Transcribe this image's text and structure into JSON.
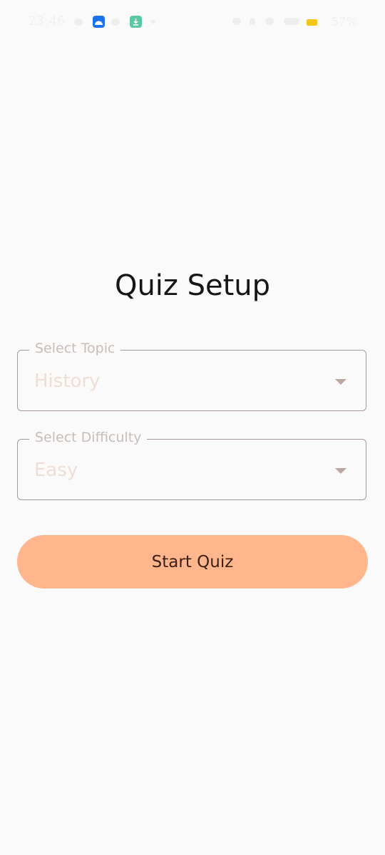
{
  "status_bar": {
    "time": "23:46",
    "battery_percent": "57%",
    "battery_color": "#f5c518",
    "app_icons": [
      "android-app-icon",
      "download-icon"
    ]
  },
  "screen": {
    "title": "Quiz Setup"
  },
  "topic_field": {
    "label": "Select Topic",
    "value": "History"
  },
  "difficulty_field": {
    "label": "Select Difficulty",
    "value": "Easy"
  },
  "start_button": {
    "label": "Start Quiz",
    "color": "#ffb68c"
  }
}
